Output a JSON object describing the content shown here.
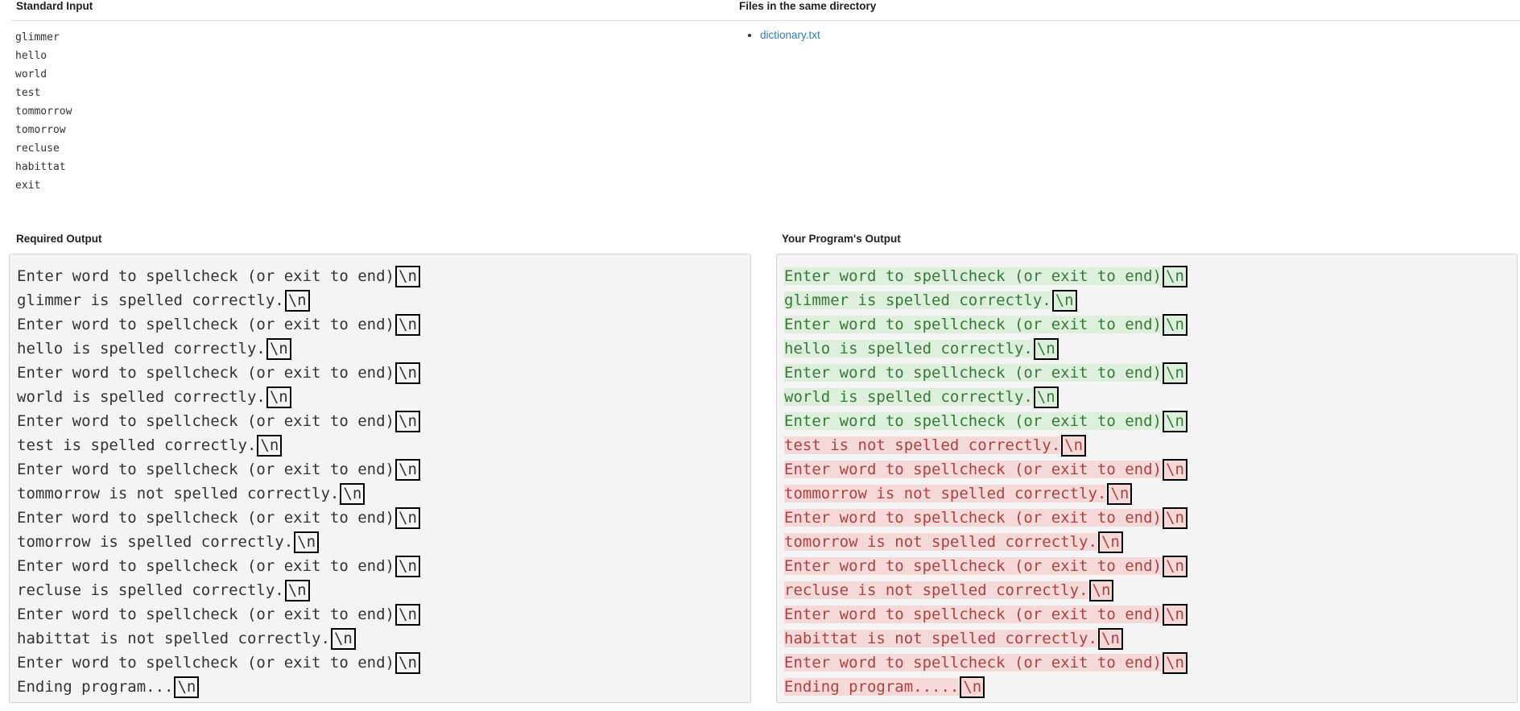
{
  "standard_input": {
    "title": "Standard Input",
    "lines": [
      "glimmer",
      "hello",
      "world",
      "test",
      "tommorrow",
      "tomorrow",
      "recluse",
      "habittat",
      "exit"
    ]
  },
  "files": {
    "title": "Files in the same directory",
    "items": [
      "dictionary.txt"
    ]
  },
  "required_output": {
    "title": "Required Output",
    "newline_marker": "\\n",
    "lines": [
      "Enter word to spellcheck (or exit to end)",
      "glimmer is spelled correctly.",
      "Enter word to spellcheck (or exit to end)",
      "hello is spelled correctly.",
      "Enter word to spellcheck (or exit to end)",
      "world is spelled correctly.",
      "Enter word to spellcheck (or exit to end)",
      "test is spelled correctly.",
      "Enter word to spellcheck (or exit to end)",
      "tommorrow is not spelled correctly.",
      "Enter word to spellcheck (or exit to end)",
      "tomorrow is spelled correctly.",
      "Enter word to spellcheck (or exit to end)",
      "recluse is spelled correctly.",
      "Enter word to spellcheck (or exit to end)",
      "habittat is not spelled correctly.",
      "Enter word to spellcheck (or exit to end)",
      "Ending program..."
    ]
  },
  "your_output": {
    "title": "Your Program's Output",
    "newline_marker": "\\n",
    "colors": {
      "match_bg": "#dcf0dc",
      "match_text": "#3c763d",
      "mismatch_bg": "#f5d8d8",
      "mismatch_text": "#a94442"
    },
    "lines": [
      {
        "text": "Enter word to spellcheck (or exit to end)",
        "status": "match"
      },
      {
        "text": "glimmer is spelled correctly.",
        "status": "match"
      },
      {
        "text": "Enter word to spellcheck (or exit to end)",
        "status": "match"
      },
      {
        "text": "hello is spelled correctly.",
        "status": "match"
      },
      {
        "text": "Enter word to spellcheck (or exit to end)",
        "status": "match"
      },
      {
        "text": "world is spelled correctly.",
        "status": "match"
      },
      {
        "text": "Enter word to spellcheck (or exit to end)",
        "status": "match"
      },
      {
        "text": "test is not spelled correctly.",
        "status": "mismatch"
      },
      {
        "text": "Enter word to spellcheck (or exit to end)",
        "status": "mismatch"
      },
      {
        "text": "tommorrow is not spelled correctly.",
        "status": "mismatch"
      },
      {
        "text": "Enter word to spellcheck (or exit to end)",
        "status": "mismatch"
      },
      {
        "text": "tomorrow is not spelled correctly.",
        "status": "mismatch"
      },
      {
        "text": "Enter word to spellcheck (or exit to end)",
        "status": "mismatch"
      },
      {
        "text": "recluse is not spelled correctly.",
        "status": "mismatch"
      },
      {
        "text": "Enter word to spellcheck (or exit to end)",
        "status": "mismatch"
      },
      {
        "text": "habittat is not spelled correctly.",
        "status": "mismatch"
      },
      {
        "text": "Enter word to spellcheck (or exit to end)",
        "status": "mismatch"
      },
      {
        "text": "Ending program.....",
        "status": "mismatch"
      }
    ]
  }
}
